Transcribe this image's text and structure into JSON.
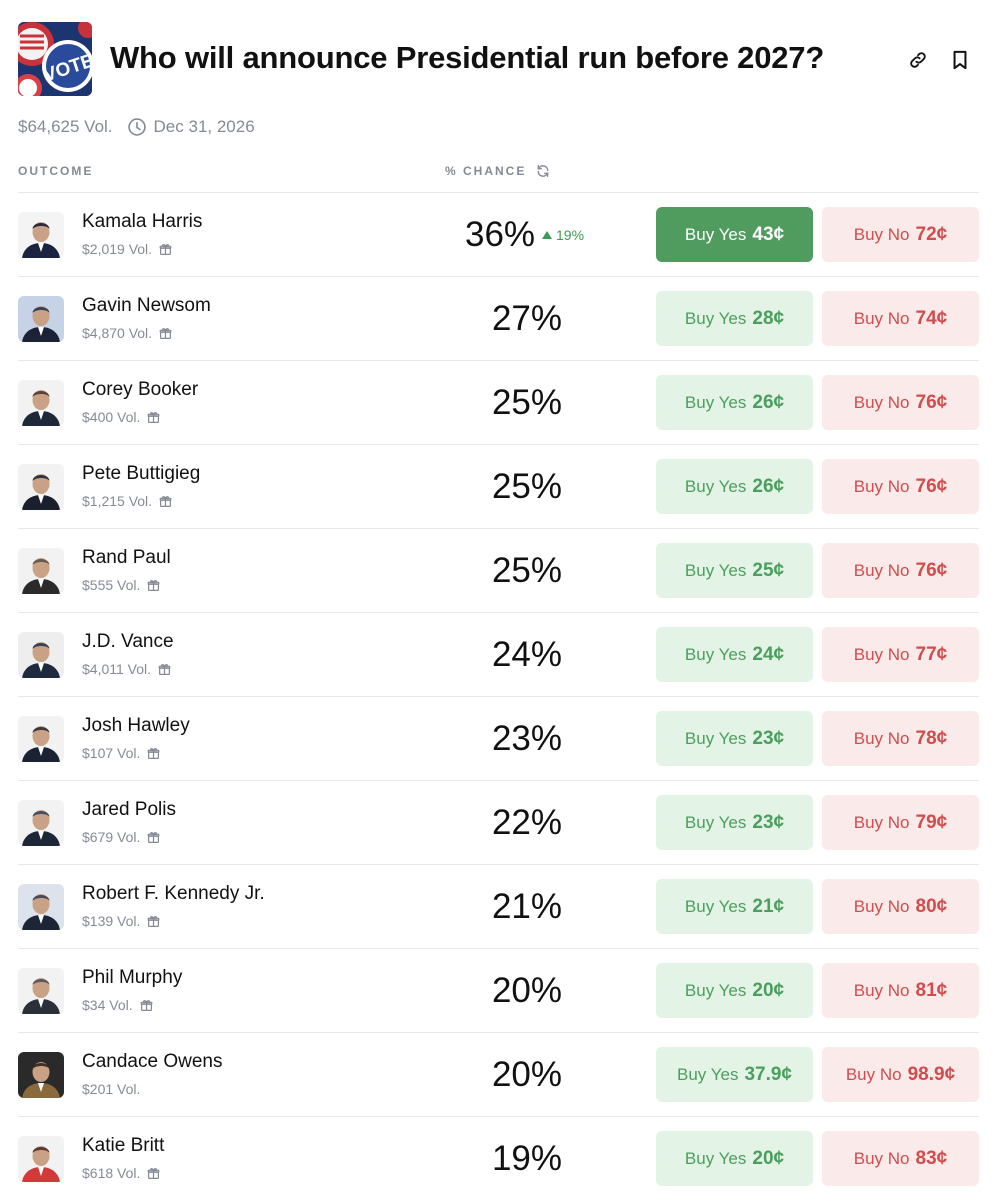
{
  "market": {
    "title": "Who will announce Presidential run before 2027?",
    "volume": "$64,625 Vol.",
    "end_date": "Dec 31, 2026",
    "thumbnail_icon": "vote-pins-image",
    "actions": {
      "link_icon": "link-icon",
      "bookmark_icon": "bookmark-icon"
    }
  },
  "columns": {
    "outcome": "OUTCOME",
    "chance": "% CHANCE"
  },
  "colors": {
    "yes_text": "#4b9e5e",
    "yes_bg": "#e3f4e7",
    "yes_active_bg": "#4f9c5e",
    "no_text": "#d24c4c",
    "no_bg": "#fbeaea",
    "muted": "#858a95"
  },
  "buy_yes_label": "Buy Yes",
  "buy_no_label": "Buy No",
  "outcomes": [
    {
      "name": "Kamala Harris",
      "volume": "$2,019 Vol.",
      "chance": "36%",
      "change": "19%",
      "yes_price": "43¢",
      "no_price": "72¢",
      "gift": true,
      "yes_active": true
    },
    {
      "name": "Gavin Newsom",
      "volume": "$4,870 Vol.",
      "chance": "27%",
      "yes_price": "28¢",
      "no_price": "74¢",
      "gift": true
    },
    {
      "name": "Corey Booker",
      "volume": "$400 Vol.",
      "chance": "25%",
      "yes_price": "26¢",
      "no_price": "76¢",
      "gift": true
    },
    {
      "name": "Pete Buttigieg",
      "volume": "$1,215 Vol.",
      "chance": "25%",
      "yes_price": "26¢",
      "no_price": "76¢",
      "gift": true
    },
    {
      "name": "Rand Paul",
      "volume": "$555 Vol.",
      "chance": "25%",
      "yes_price": "25¢",
      "no_price": "76¢",
      "gift": true
    },
    {
      "name": "J.D. Vance",
      "volume": "$4,011 Vol.",
      "chance": "24%",
      "yes_price": "24¢",
      "no_price": "77¢",
      "gift": true
    },
    {
      "name": "Josh Hawley",
      "volume": "$107 Vol.",
      "chance": "23%",
      "yes_price": "23¢",
      "no_price": "78¢",
      "gift": true
    },
    {
      "name": "Jared Polis",
      "volume": "$679 Vol.",
      "chance": "22%",
      "yes_price": "23¢",
      "no_price": "79¢",
      "gift": true
    },
    {
      "name": "Robert F. Kennedy Jr.",
      "volume": "$139 Vol.",
      "chance": "21%",
      "yes_price": "21¢",
      "no_price": "80¢",
      "gift": true
    },
    {
      "name": "Phil Murphy",
      "volume": "$34 Vol.",
      "chance": "20%",
      "yes_price": "20¢",
      "no_price": "81¢",
      "gift": true
    },
    {
      "name": "Candace Owens",
      "volume": "$201 Vol.",
      "chance": "20%",
      "yes_price": "37.9¢",
      "no_price": "98.9¢",
      "gift": false
    },
    {
      "name": "Katie Britt",
      "volume": "$618 Vol.",
      "chance": "19%",
      "yes_price": "20¢",
      "no_price": "83¢",
      "gift": true
    }
  ]
}
